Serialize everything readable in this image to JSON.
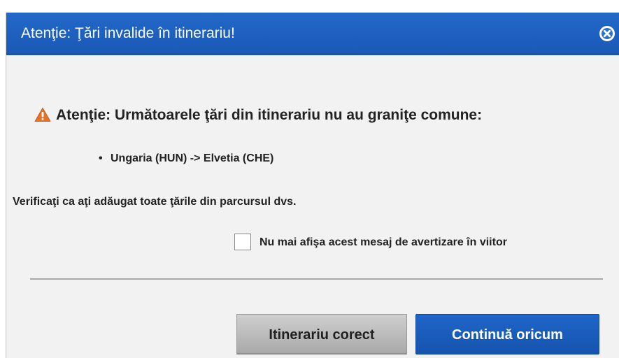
{
  "dialog": {
    "title": "Atenţie: Ţări invalide în itinerariu!",
    "close_icon": "close-circle-icon",
    "warning_icon": "warning-triangle-icon",
    "warning_heading": "Atenţie: Următoarele ţări din itinerariu nu au graniţe comune:",
    "issues": [
      "Ungaria (HUN) -> Elvetia (CHE)"
    ],
    "verify_text": "Verificaţi ca aţi adăugat toate ţările din parcursul dvs.",
    "dont_show_again": {
      "label": "Nu mai afişa acest mesaj de avertizare în viitor",
      "checked": false
    },
    "buttons": {
      "correct_itinerary": "Itinerariu corect",
      "continue_anyway": "Continuă oricum"
    }
  },
  "colors": {
    "title_bar": "#1d5fbf",
    "primary_button": "#1a5cbd",
    "warning_icon": "#e2732a",
    "dialog_background": "#f2f2f2"
  }
}
